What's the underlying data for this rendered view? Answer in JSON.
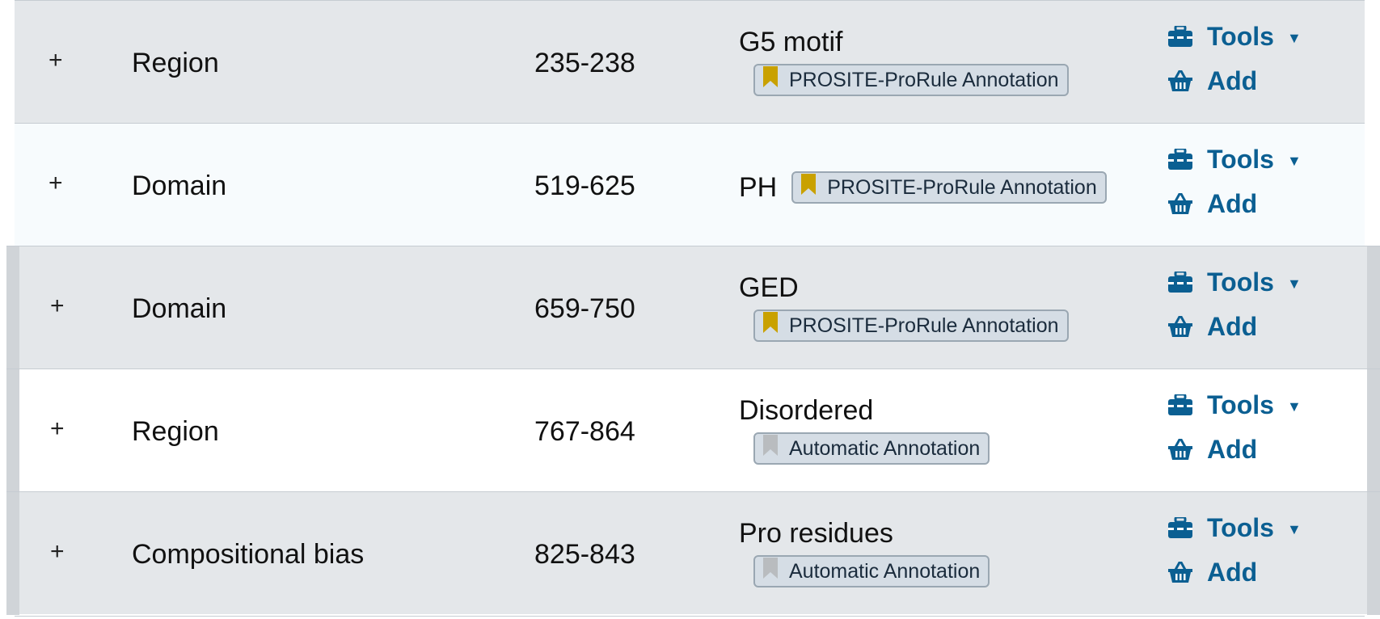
{
  "features": [
    {
      "expand": "+",
      "type": "Region",
      "position": "235-238",
      "description": "G5 motif",
      "evidence": "PROSITE-ProRule Annotation",
      "evidence_color": "#c9a100",
      "tools": "Tools",
      "add": "Add"
    },
    {
      "expand": "+",
      "type": "Domain",
      "position": "519-625",
      "description": "PH",
      "evidence": "PROSITE-ProRule Annotation",
      "evidence_color": "#c9a100",
      "tools": "Tools",
      "add": "Add"
    },
    {
      "expand": "+",
      "type": "Domain",
      "position": "659-750",
      "description": "GED",
      "evidence": "PROSITE-ProRule Annotation",
      "evidence_color": "#c9a100",
      "tools": "Tools",
      "add": "Add"
    },
    {
      "expand": "+",
      "type": "Region",
      "position": "767-864",
      "description": "Disordered",
      "evidence": "Automatic Annotation",
      "evidence_color": "#b9bcbf",
      "tools": "Tools",
      "add": "Add"
    },
    {
      "expand": "+",
      "type": "Compositional bias",
      "position": "825-843",
      "description": "Pro residues",
      "evidence": "Automatic Annotation",
      "evidence_color": "#b9bcbf",
      "tools": "Tools",
      "add": "Add"
    }
  ],
  "icons": {
    "tools": "toolbox-icon",
    "add": "basket-icon",
    "evidence": "bookmark-icon",
    "dropdown": "caret-down-icon"
  },
  "colors": {
    "link": "#0b5f92",
    "badge_bg": "#d5dde5",
    "row_grey": "#e4e7ea"
  }
}
